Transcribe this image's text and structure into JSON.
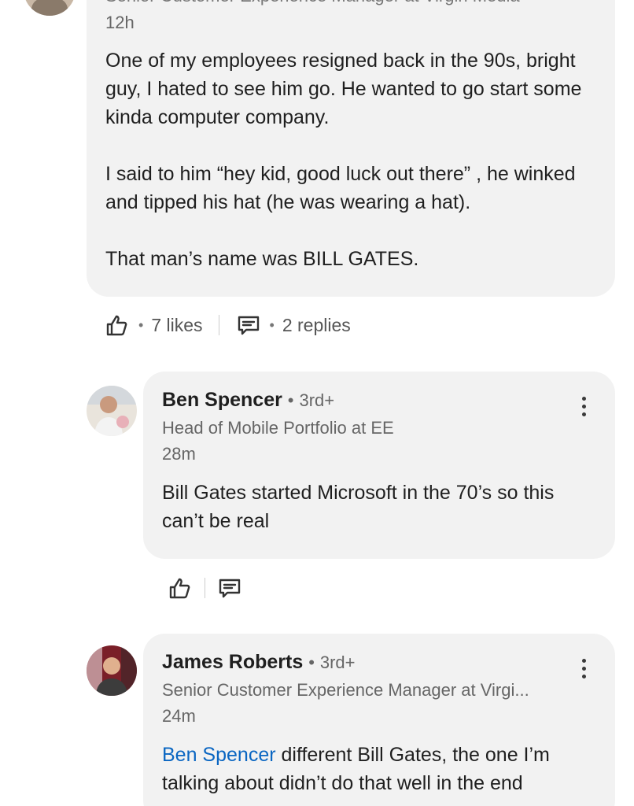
{
  "top_comment": {
    "headline_partial": "Senior Customer Experience Manager at Virgin Media",
    "timestamp": "12h",
    "body": [
      "One of my employees resigned back in the 90s, bright guy, I hated to see him go. He wanted to go start some kinda computer company.",
      "I said to him “hey kid, good luck out there” , he winked and tipped his hat (he was wearing a hat).",
      "That man’s name was BILL GATES."
    ],
    "likes_label": "7 likes",
    "replies_label": "2 replies",
    "like_icon": "thumbs-up-icon",
    "reply_icon": "comment-icon"
  },
  "replies": [
    {
      "name": "Ben Spencer",
      "degree": "3rd+",
      "headline": "Head of Mobile Portfolio at EE",
      "timestamp": "28m",
      "body": "Bill Gates started Microsoft in the 70’s so this can’t be real"
    },
    {
      "name": "James Roberts",
      "degree": "3rd+",
      "headline": "Senior Customer Experience Manager at Virgi...",
      "timestamp": "24m",
      "mention": "Ben Spencer",
      "body": " different Bill Gates, the one I’m talking about didn’t do that well in the end"
    }
  ],
  "separator_dot": "•",
  "colors": {
    "bubble": "#f2f2f2",
    "mention": "#0a66c2",
    "secondary_text": "#666666"
  }
}
